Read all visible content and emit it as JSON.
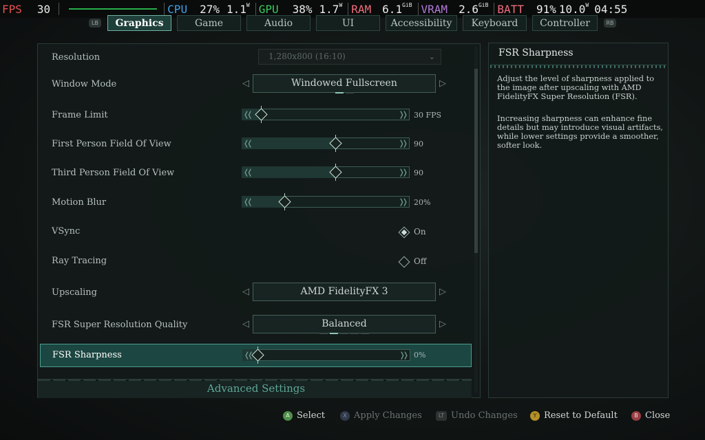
{
  "perf": {
    "fps_label": "FPS",
    "fps": "30",
    "cpu_label": "CPU",
    "cpu_pct": "27%",
    "cpu_watts": "1.1",
    "cpu_watts_unit": "W",
    "gpu_label": "GPU",
    "gpu_pct": "38%",
    "gpu_watts": "1.7",
    "gpu_watts_unit": "W",
    "ram_label": "RAM",
    "ram_val": "6.1",
    "ram_unit": "GiB",
    "vram_label": "VRAM",
    "vram_val": "2.6",
    "vram_unit": "GiB",
    "batt_label": "BATT",
    "batt_pct": "91%",
    "batt_watts": "10.0",
    "batt_watts_unit": "W",
    "clock": "04:55",
    "colors": {
      "fps": "#e4534f",
      "cpu": "#3ea2e8",
      "gpu": "#39c95c",
      "ram": "#ee6d7b",
      "vram": "#b07ad8",
      "batt": "#ee6d7b"
    }
  },
  "tabs": {
    "left_bumper": "LB",
    "right_bumper": "RB",
    "items": [
      {
        "label": "Graphics",
        "active": true
      },
      {
        "label": "Game"
      },
      {
        "label": "Audio"
      },
      {
        "label": "UI"
      },
      {
        "label": "Accessibility"
      },
      {
        "label": "Keyboard"
      },
      {
        "label": "Controller"
      }
    ]
  },
  "settings": {
    "resolution": {
      "label": "Resolution",
      "value": "1,280x800 (16:10)",
      "disabled": true
    },
    "window_mode": {
      "label": "Window Mode",
      "value": "Windowed Fullscreen",
      "option_count": 2,
      "selected_index": 0
    },
    "frame_limit": {
      "label": "Frame Limit",
      "value": "30 FPS",
      "level": 0.03
    },
    "fp_fov": {
      "label": "First Person Field Of View",
      "value": "90",
      "level": 0.57
    },
    "tp_fov": {
      "label": "Third Person Field Of View",
      "value": "90",
      "level": 0.57
    },
    "motion_blur": {
      "label": "Motion Blur",
      "value": "20%",
      "level": 0.2
    },
    "vsync": {
      "label": "VSync",
      "value": "On",
      "on": true
    },
    "ray_tracing": {
      "label": "Ray Tracing",
      "value": "Off",
      "on": false
    },
    "upscaling": {
      "label": "Upscaling",
      "value": "AMD FidelityFX 3"
    },
    "fsr_quality": {
      "label": "FSR Super Resolution Quality",
      "value": "Balanced",
      "option_count": 5,
      "selected_index": 1
    },
    "fsr_sharpness": {
      "label": "FSR Sharpness",
      "value": "0%",
      "level": 0.0,
      "selected": true
    },
    "advanced": "Advanced Settings",
    "accent": "#4c9f91"
  },
  "description": {
    "title": "FSR Sharpness",
    "p1": "Adjust the level of sharpness applied to the image after upscaling with AMD FidelityFX Super Resolution (FSR).",
    "p2": "Increasing sharpness can enhance fine details but may introduce visual artifacts, while lower settings provide a smoother, softer look."
  },
  "footer": {
    "select": {
      "btn": "A",
      "label": "Select",
      "color": "#4f8f4a"
    },
    "apply": {
      "btn": "X",
      "label": "Apply Changes",
      "color": "#303a4a"
    },
    "undo": {
      "btn": "LT",
      "label": "Undo Changes",
      "color": "#2e3332"
    },
    "reset": {
      "btn": "Y",
      "label": "Reset to Default",
      "color": "#b58f27"
    },
    "close": {
      "btn": "B",
      "label": "Close",
      "color": "#9a3e44"
    }
  }
}
